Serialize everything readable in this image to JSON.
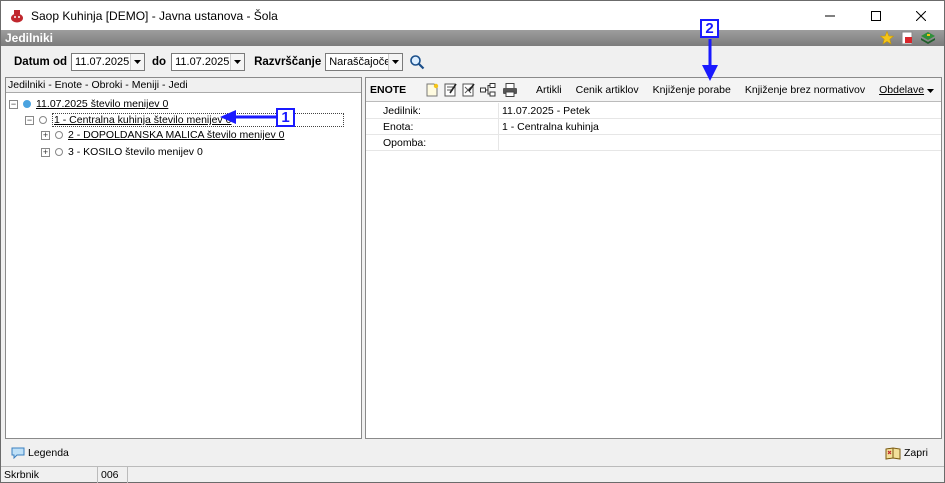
{
  "window": {
    "title": "Saop Kuhinja  [DEMO] - Javna ustanova - Šola"
  },
  "header": {
    "title": "Jedilniki"
  },
  "filter": {
    "date_from_label": "Datum od",
    "date_from_value": "11.07.2025",
    "date_to_label": "do",
    "date_to_value": "11.07.2025",
    "sort_label": "Razvrščanje",
    "sort_value": "Naraščajoče"
  },
  "tree": {
    "header": "Jedilniki - Enote - Obroki - Meniji - Jedi",
    "root": "11.07.2025   število menijev 0",
    "unit": "1 - Centralna kuhinja   število menijev 0",
    "meals": [
      "2 - DOPOLDANSKA MALICA   število menijev 0",
      "3 - KOSILO   število menijev 0"
    ]
  },
  "toolbar": {
    "title": "ENOTE",
    "artikli": "Artikli",
    "cenik": "Cenik artiklov",
    "knjizenje_porabe": "Knjiženje porabe",
    "knjizenje_brez": "Knjiženje brez normativov",
    "obdelave": "Obdelave"
  },
  "details": [
    {
      "label": "Jedilnik:",
      "value": "11.07.2025 - Petek"
    },
    {
      "label": "Enota:",
      "value": "1 - Centralna kuhinja"
    },
    {
      "label": "Opomba:",
      "value": ""
    }
  ],
  "footer": {
    "legenda": "Legenda",
    "zapri": "Zapri"
  },
  "status": {
    "user": "Skrbnik",
    "code": "006"
  },
  "callouts": {
    "one": "1",
    "two": "2"
  },
  "colors": {
    "callout": "#1a1aff",
    "header_bar": "#8a8a8a",
    "tree_root_dot": "#4aa3e0"
  }
}
